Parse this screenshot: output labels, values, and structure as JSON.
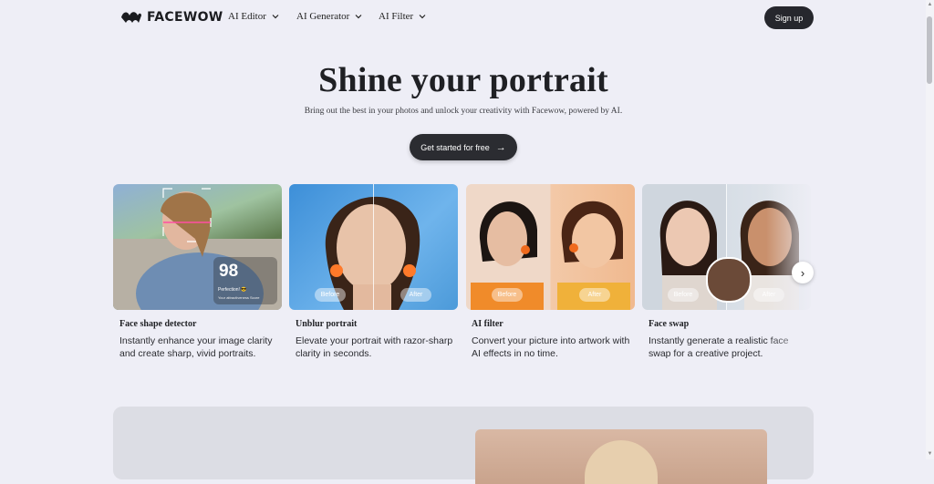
{
  "header": {
    "brand": "FACEWOW",
    "nav": [
      {
        "label": "AI Editor"
      },
      {
        "label": "AI Generator"
      },
      {
        "label": "AI Filter"
      }
    ],
    "signup_label": "Sign up"
  },
  "hero": {
    "title": "Shine your portrait",
    "subtitle": "Bring out the best in your photos and unlock your creativity with Facewow, powered by AI.",
    "cta_label": "Get started for free"
  },
  "cards": [
    {
      "title": "Face shape detector",
      "description": "Instantly enhance your image clarity and create sharp, vivid portraits.",
      "score": "98",
      "score_caption": "Perfection! 😎",
      "score_sub": "Your attractiveness Score"
    },
    {
      "title": "Unblur portrait",
      "description": "Elevate your portrait with razor-sharp clarity in seconds.",
      "before_label": "Before",
      "after_label": "After"
    },
    {
      "title": "AI filter",
      "description": "Convert your picture into artwork with AI effects in no time.",
      "before_label": "Before",
      "after_label": "After"
    },
    {
      "title": "Face swap",
      "description": "Instantly generate a realistic face swap for a creative project.",
      "before_label": "Before",
      "after_label": "After"
    }
  ],
  "icons": {
    "chevron": "chevron-down-icon",
    "arrow": "arrow-right-icon",
    "next": "chevron-right-icon"
  },
  "colors": {
    "background": "#eeeef6",
    "button_dark": "#26272d"
  }
}
